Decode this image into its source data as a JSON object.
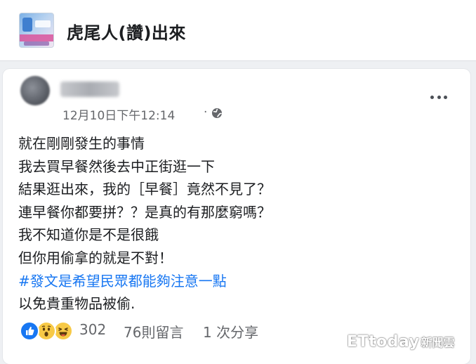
{
  "group": {
    "name": "虎尾人(讚)出來",
    "avatar_icon": "group-cover-thumbnail"
  },
  "post": {
    "author": "",
    "timestamp": "12月10日下午12:14",
    "separator": "·",
    "privacy_icon": "globe-icon",
    "more_icon": "more-options-icon",
    "lines": [
      "就在剛剛發生的事情",
      "我去買早餐然後去中正街逛一下",
      "結果逛出來，我的［早餐］竟然不見了？",
      "連早餐你都要拼？？是真的有那麼窮嗎？",
      "我不知道你是不是很餓",
      "但你用偷拿的就是不對！",
      "#發文是希望民眾都能夠注意一點",
      "以免貴重物品被偷."
    ],
    "hashtag_line_index": 6
  },
  "engagement": {
    "reaction_icons": [
      "like-icon",
      "wow-icon",
      "haha-icon"
    ],
    "reaction_count": "302",
    "comments": "76則留言",
    "shares": "1 次分享"
  },
  "watermark": {
    "brand": "ETtoday",
    "sub": "新聞雲"
  },
  "colors": {
    "hashtag": "#1877f2",
    "meta_text": "#65676b",
    "like_blue": "#1877f2",
    "emoji_yellow": "#f7c946"
  }
}
